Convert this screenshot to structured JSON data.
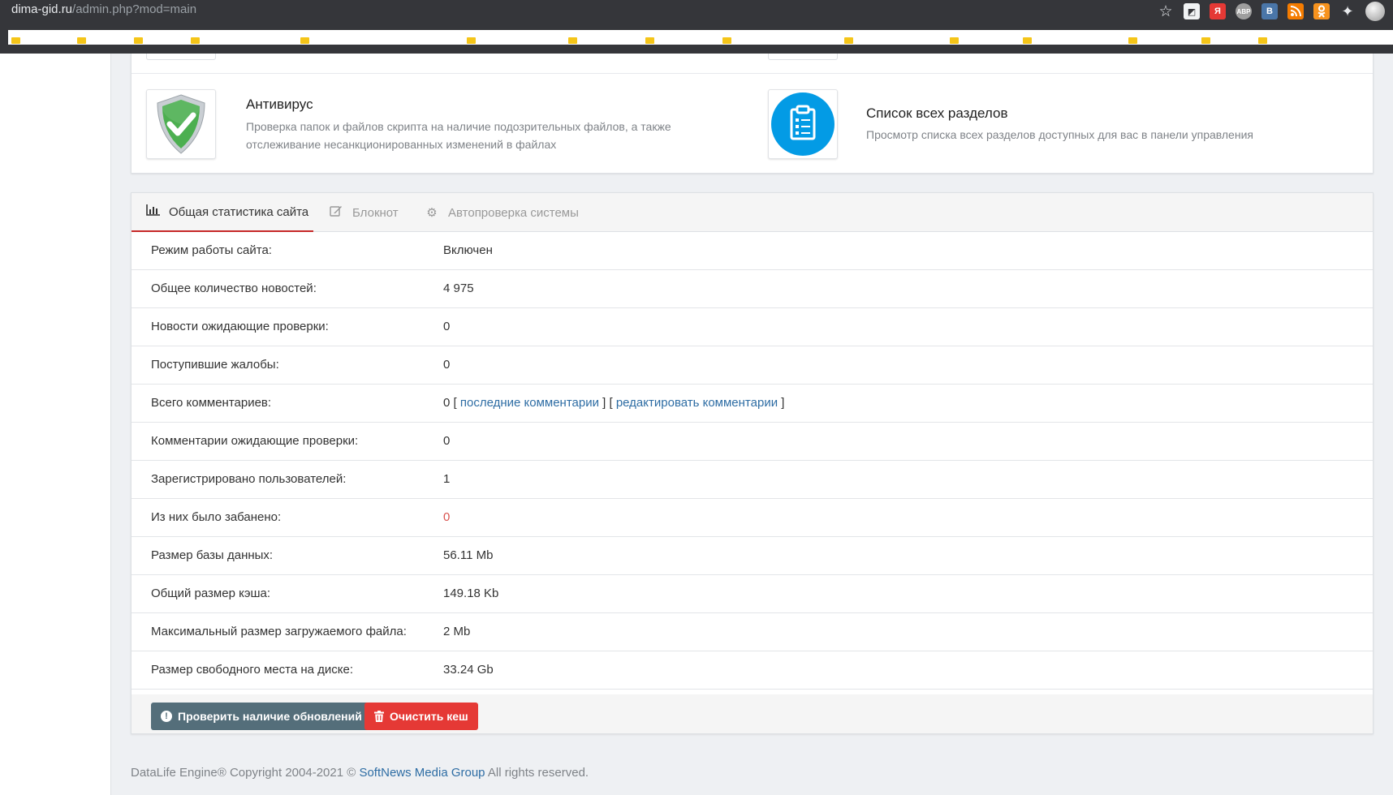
{
  "browser": {
    "url_host": "dima-gid.ru",
    "url_path": "/admin.php?mod=main",
    "toolbar_icons": [
      "star-icon",
      "ext-icon",
      "yandex-icon",
      "adblock-icon",
      "vk-icon",
      "rss-icon",
      "ok-icon",
      "puzzle-icon",
      "profile-avatar"
    ],
    "ext_labels": {
      "yandex": "Я",
      "adblock": "ABP",
      "vk": "B"
    }
  },
  "modules": [
    {
      "title": "Антивирус",
      "desc_line1": "Проверка папок и файлов скрипта на наличие подозрительных файлов, а также",
      "desc_line2": "отслеживание несанкционированных изменений в файлах",
      "icon": "shield-check-icon"
    },
    {
      "title": "Список всех разделов",
      "desc_line1": "Просмотр списка всех разделов доступных для вас в панели управления",
      "icon": "clipboard-list-icon"
    }
  ],
  "tabs": [
    {
      "label": "Общая статистика сайта",
      "icon": "bar-chart-icon",
      "active": true
    },
    {
      "label": "Блокнот",
      "icon": "edit-icon",
      "active": false
    },
    {
      "label": "Автопроверка системы",
      "icon": "gear-icon",
      "active": false
    }
  ],
  "stats": [
    {
      "label": "Режим работы сайта:",
      "value": "Включен"
    },
    {
      "label": "Общее количество новостей:",
      "value": "4 975"
    },
    {
      "label": "Новости ожидающие проверки:",
      "value": "0"
    },
    {
      "label": "Поступившие жалобы:",
      "value": "0"
    },
    {
      "label": "Всего комментариев:",
      "value": "0",
      "link1": "последние комментарии",
      "link2": "редактировать комментарии"
    },
    {
      "label": "Комментарии ожидающие проверки:",
      "value": "0"
    },
    {
      "label": "Зарегистрировано пользователей:",
      "value": "1"
    },
    {
      "label": "Из них было забанено:",
      "value": "0"
    },
    {
      "label": "Размер базы данных:",
      "value": "56.11 Mb"
    },
    {
      "label": "Общий размер кэша:",
      "value": "149.18 Kb"
    },
    {
      "label": "Максимальный размер загружаемого файла:",
      "value": "2 Mb"
    },
    {
      "label": "Размер свободного места на диске:",
      "value": "33.24 Gb"
    }
  ],
  "buttons": {
    "check_updates": "Проверить наличие обновлений",
    "clear_cache": "Очистить кеш"
  },
  "footer": {
    "prefix": "DataLife Engine® Copyright 2004-2021 ©",
    "company": "SoftNews Media Group",
    "suffix": "All rights reserved."
  },
  "colors": {
    "accent_red": "#c62828",
    "link": "#2e6da4",
    "button_update": "#546e7a",
    "button_cache": "#e53935",
    "banned_value": "#d9534f"
  }
}
